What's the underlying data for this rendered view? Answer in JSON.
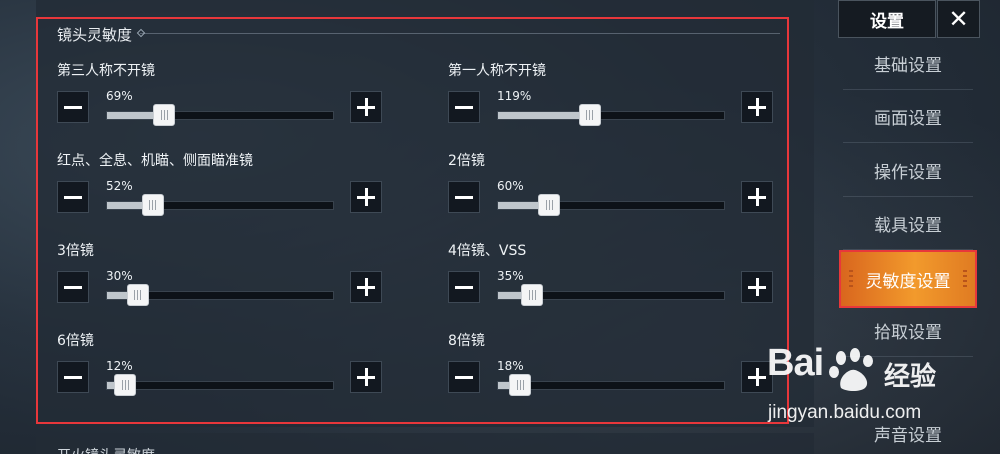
{
  "section": {
    "title": "镜头灵敏度",
    "next_title": "开火镜头灵敏度"
  },
  "sliders": [
    {
      "label": "第三人称不开镜",
      "value_text": "69%",
      "value": 69,
      "max": 300
    },
    {
      "label": "第一人称不开镜",
      "value_text": "119%",
      "value": 119,
      "max": 300
    },
    {
      "label": "红点、全息、机瞄、侧面瞄准镜",
      "value_text": "52%",
      "value": 52,
      "max": 300
    },
    {
      "label": "2倍镜",
      "value_text": "60%",
      "value": 60,
      "max": 300
    },
    {
      "label": "3倍镜",
      "value_text": "30%",
      "value": 30,
      "max": 300
    },
    {
      "label": "4倍镜、VSS",
      "value_text": "35%",
      "value": 35,
      "max": 300
    },
    {
      "label": "6倍镜",
      "value_text": "12%",
      "value": 12,
      "max": 300
    },
    {
      "label": "8倍镜",
      "value_text": "18%",
      "value": 18,
      "max": 300
    }
  ],
  "sidebar": {
    "title": "设置",
    "close_icon": "close-icon",
    "items": [
      {
        "label": "基础设置",
        "active": false
      },
      {
        "label": "画面设置",
        "active": false
      },
      {
        "label": "操作设置",
        "active": false
      },
      {
        "label": "载具设置",
        "active": false
      },
      {
        "label": "灵敏度设置",
        "active": true
      },
      {
        "label": "拾取设置",
        "active": false
      },
      {
        "label": "声音设置",
        "active": false
      }
    ]
  },
  "watermark": {
    "logo": "Bai",
    "logo_suffix": "经验",
    "url": "jingyan.baidu.com"
  },
  "colors": {
    "accent_active": "#f29a2c",
    "highlight_border": "#e8373b"
  }
}
